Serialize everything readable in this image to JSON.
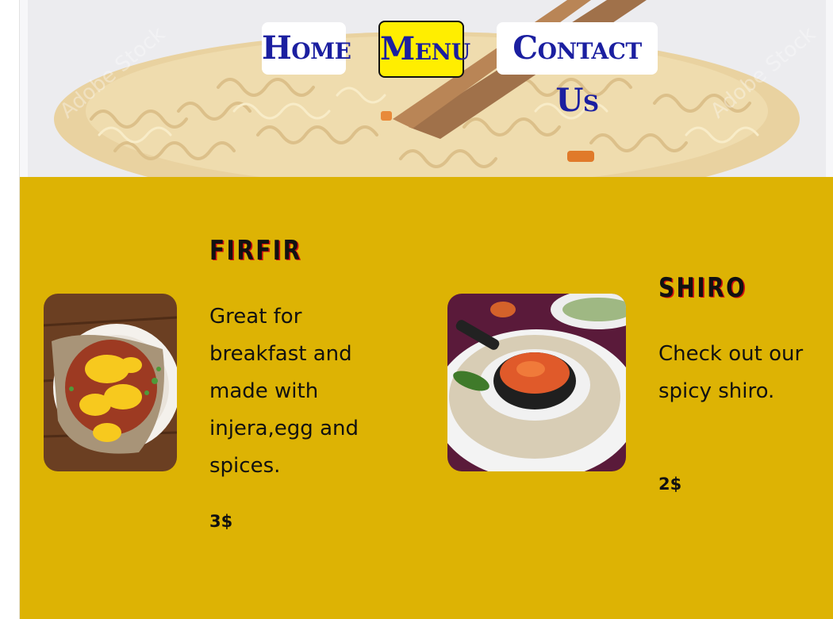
{
  "nav": {
    "home_label": "Home",
    "menu_label": "Menu",
    "contact_label": "Contact Us"
  },
  "hero": {
    "watermark": "Adobe Stock"
  },
  "colors": {
    "nav_text": "#1b1fa0",
    "active_nav_bg": "#ffee00",
    "section_bg": "#ddb304",
    "title_shadow": "#d21010"
  },
  "dishes": [
    {
      "name": "FIRFIR",
      "description": "Great for breakfast and made with injera,egg and spices.",
      "price": "3$"
    },
    {
      "name": "SHIRO",
      "description": "Check out our spicy shiro.",
      "price": "2$"
    }
  ]
}
